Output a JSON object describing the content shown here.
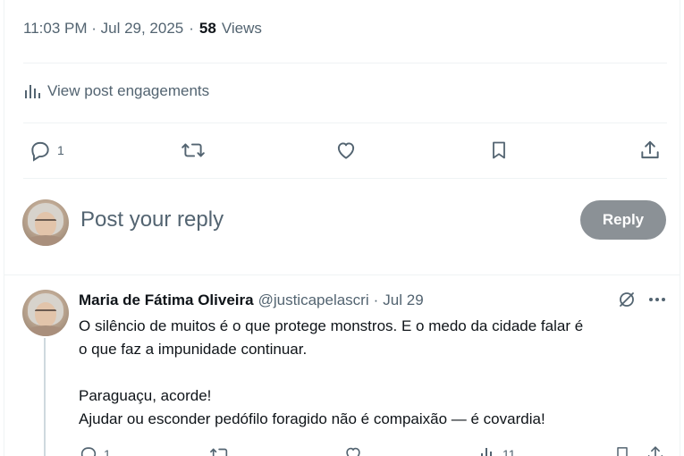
{
  "meta": {
    "time": "11:03 PM · Jul 29, 2025",
    "dot": "·",
    "views_count": "58",
    "views_label": "Views"
  },
  "engagements": {
    "label": "View post engagements",
    "icon": "analytics-bars-icon"
  },
  "actions": {
    "reply_count": "1",
    "retweet_count": "",
    "like_count": "",
    "icons": [
      "reply-icon",
      "retweet-icon",
      "like-heart-icon",
      "bookmark-icon",
      "share-icon"
    ]
  },
  "reply_composer": {
    "placeholder": "Post your reply",
    "button_label": "Reply"
  },
  "reply_post": {
    "author_name": "Maria de Fátima Oliveira",
    "handle": "@justicapelascri",
    "sep": "·",
    "date": "Jul 29",
    "text_lines": [
      "O silêncio de muitos é o que protege monstros. E o medo da cidade falar é",
      "o que faz a impunidade continuar.",
      "",
      "Paraguaçu, acorde!",
      "Ajudar ou esconder pedófilo foragido não é compaixão — é covardia!"
    ],
    "reply_count": "1",
    "views_count": "11"
  },
  "colors": {
    "muted": "#536471",
    "text": "#0f1419",
    "divider": "#eff3f4",
    "reply_button_bg": "#8b9196"
  }
}
